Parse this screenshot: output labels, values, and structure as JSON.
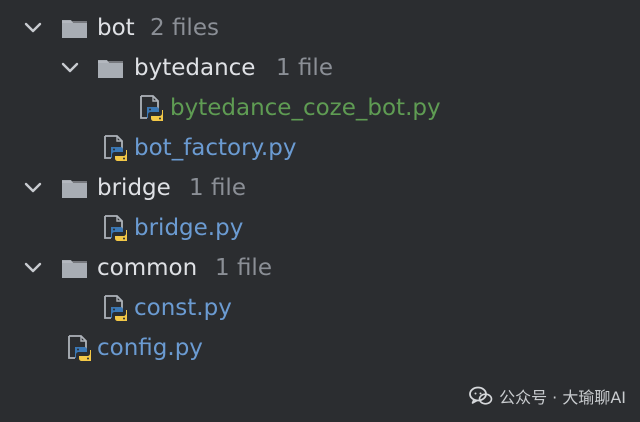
{
  "tree": {
    "top_fragment": "— — — — — — — — — — — — — — — — — — — — — — — — — — —",
    "bot": {
      "label": "bot",
      "count": "2 files"
    },
    "bytedance": {
      "label": "bytedance",
      "count": "1 file"
    },
    "bytedance_coze_bot": {
      "label": "bytedance_coze_bot.py"
    },
    "bot_factory": {
      "label": "bot_factory.py"
    },
    "bridge": {
      "label": "bridge",
      "count": "1 file"
    },
    "bridge_py": {
      "label": "bridge.py"
    },
    "common": {
      "label": "common",
      "count": "1 file"
    },
    "const_py": {
      "label": "const.py"
    },
    "config_py": {
      "label": "config.py"
    }
  },
  "watermark": {
    "text": "公众号 · 大瑜聊AI"
  },
  "colors": {
    "background": "#2b2d30",
    "folder_text": "#dfe1e5",
    "file_text": "#6b9bd2",
    "modified_text": "#5f9c53",
    "count_text": "#8b8f96"
  },
  "icons": {
    "expanded": "chevron-down-icon",
    "folder": "folder-icon",
    "python_file": "python-file-icon",
    "wechat": "wechat-icon"
  }
}
